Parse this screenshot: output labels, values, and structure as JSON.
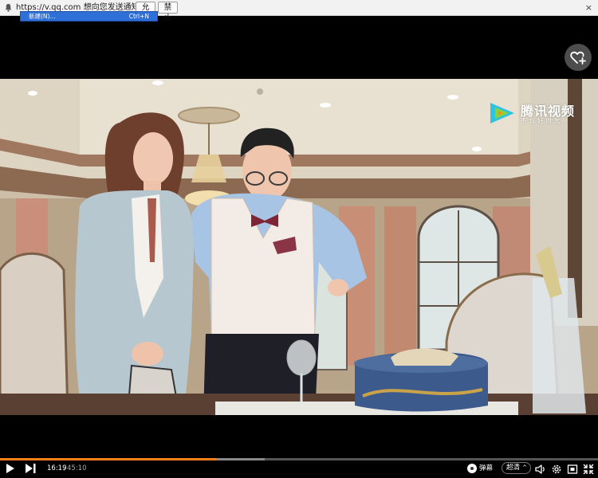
{
  "notification": {
    "message": "https://v.qq.com 想向您发送通知。",
    "allow_label": "允许",
    "block_label": "禁止",
    "close_glyph": "×"
  },
  "context_menu": {
    "item_label": "新建(N)...",
    "item_shortcut": "Ctrl+N"
  },
  "overlay": {
    "logo_name": "腾讯视频",
    "logo_slogan": "不负好时光",
    "favorite_icon": "heart-plus-icon"
  },
  "controls": {
    "current_time": "16:19",
    "separator": "/",
    "total_time": "45:10",
    "played_fraction": 0.361,
    "buffered_fraction": 0.443,
    "danmu_label": "弹幕",
    "quality_label": "超清",
    "quality_caret": "^",
    "accent_color": "#ff7f1a"
  }
}
